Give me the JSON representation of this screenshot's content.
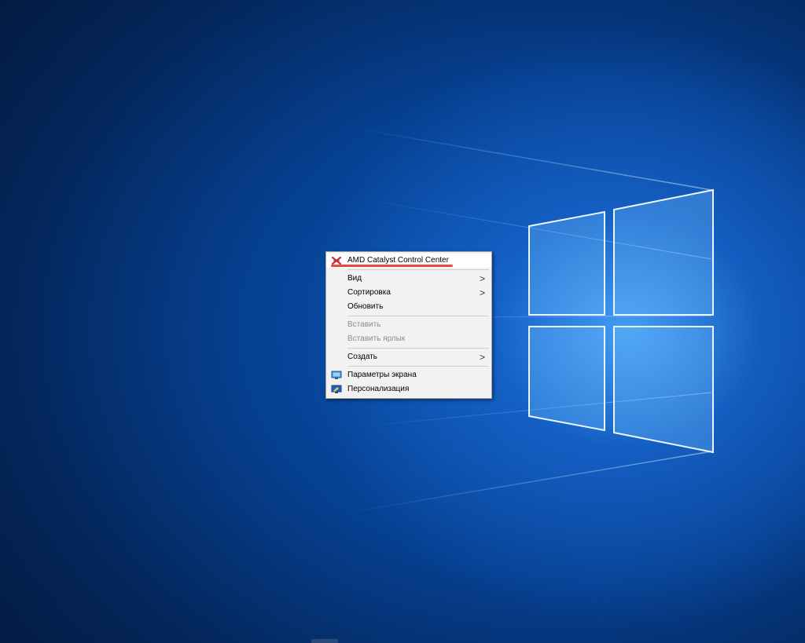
{
  "desktop": {
    "wallpaper_colors": {
      "deep": "#021a40",
      "mid": "#0a57b8",
      "glow": "#50aaff"
    }
  },
  "context_menu": {
    "items": [
      {
        "id": "amd",
        "label": "AMD Catalyst Control Center",
        "icon": "amd-icon",
        "submenu": false,
        "disabled": false,
        "highlighted": true
      },
      {
        "id": "view",
        "label": "Вид",
        "submenu": true,
        "disabled": false
      },
      {
        "id": "sort",
        "label": "Сортировка",
        "submenu": true,
        "disabled": false
      },
      {
        "id": "refresh",
        "label": "Обновить",
        "submenu": false,
        "disabled": false
      },
      {
        "id": "paste",
        "label": "Вставить",
        "submenu": false,
        "disabled": true
      },
      {
        "id": "paste_shortcut",
        "label": "Вставить ярлык",
        "submenu": false,
        "disabled": true
      },
      {
        "id": "new",
        "label": "Создать",
        "submenu": true,
        "disabled": false
      },
      {
        "id": "display_settings",
        "label": "Параметры экрана",
        "icon": "display-icon",
        "submenu": false,
        "disabled": false
      },
      {
        "id": "personalize",
        "label": "Персонализация",
        "icon": "personalize-icon",
        "submenu": false,
        "disabled": false
      }
    ],
    "submenu_arrow": ">",
    "annotation_color": "#e84b3d"
  }
}
